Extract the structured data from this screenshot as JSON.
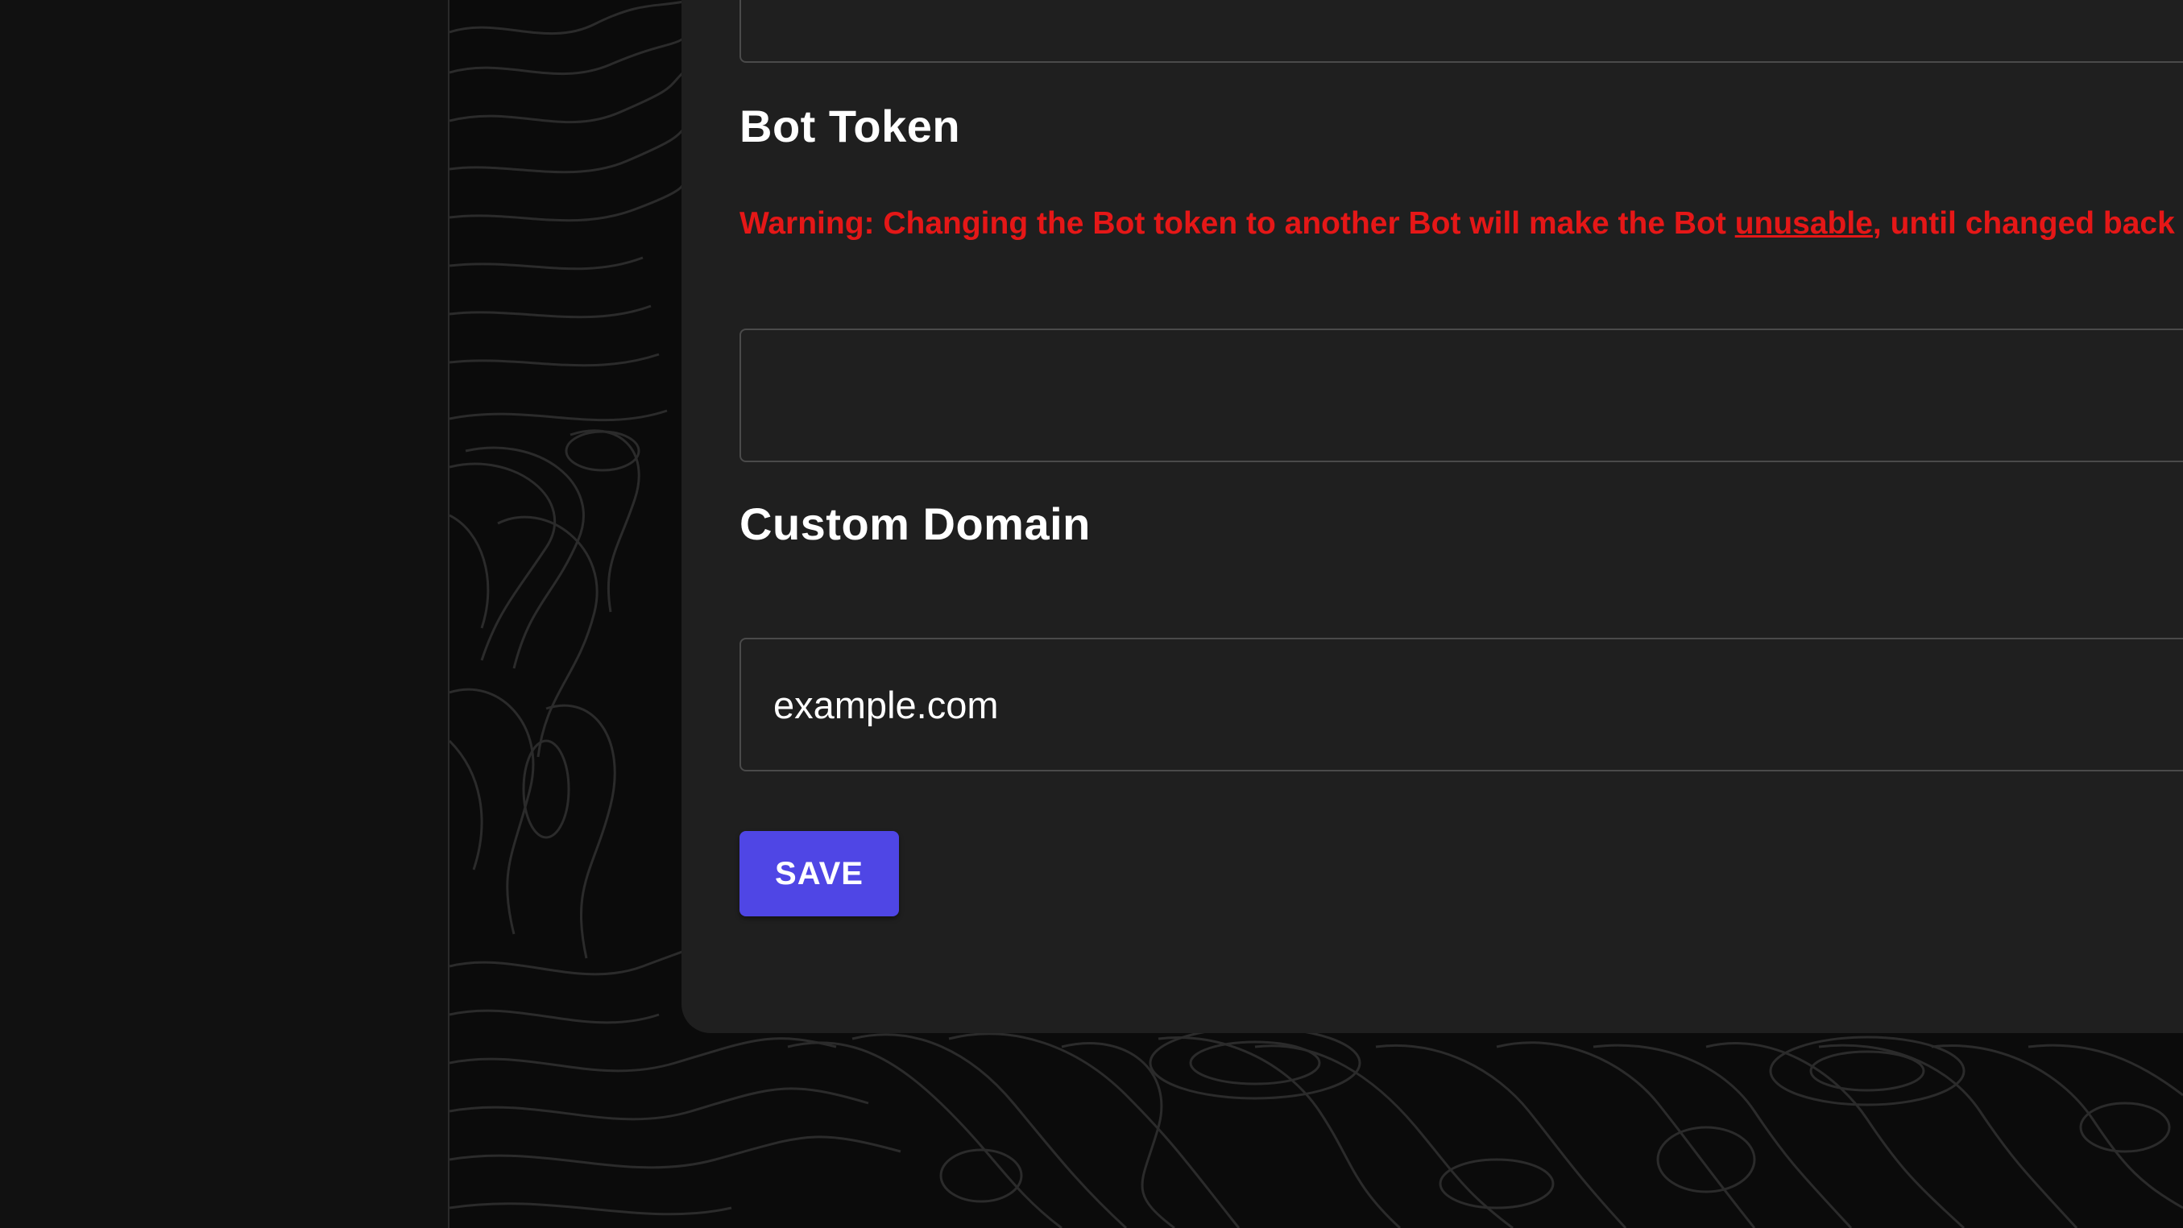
{
  "colors": {
    "background": "#0b0b0b",
    "sidebar": "#111111",
    "card": "#1f1f1f",
    "warning": "#e51717",
    "primary": "#4f46e5",
    "input_border": "#4a4a4a"
  },
  "bot_token": {
    "title": "Bot Token",
    "warning_prefix": "Warning: Changing the Bot token to another Bot will make the Bot ",
    "warning_emphasis": "unusable",
    "warning_suffix": ", until changed back",
    "value": ""
  },
  "custom_domain": {
    "title": "Custom Domain",
    "placeholder": "example.com",
    "value": ""
  },
  "actions": {
    "save_label": "SAVE"
  }
}
